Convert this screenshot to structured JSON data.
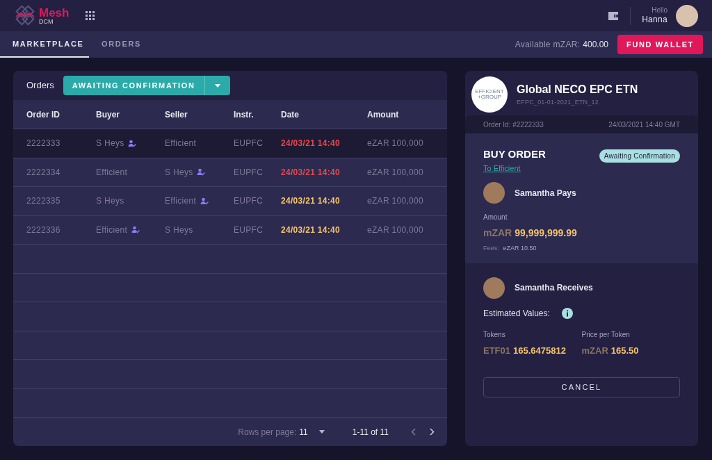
{
  "header": {
    "brand": "Mesh",
    "brand_sub": "DCM",
    "greeting": "Hello",
    "user": "Hanna"
  },
  "tabs": [
    {
      "label": "MARKETPLACE",
      "selected": true
    },
    {
      "label": "ORDERS",
      "selected": false
    }
  ],
  "wallet": {
    "label": "Available mZAR:",
    "value": "400.00",
    "button": "FUND WALLET"
  },
  "orders": {
    "title": "Orders",
    "filter": "AWAITING CONFIRMATION",
    "columns": [
      "Order ID",
      "Buyer",
      "Seller",
      "Instr.",
      "Date",
      "Amount"
    ],
    "rows": [
      {
        "id": "2222333",
        "buyer": {
          "name": "S Heys",
          "verified": true
        },
        "seller": {
          "name": "Efficient",
          "verified": false
        },
        "instr": "EUPFC",
        "date": "24/03/21 14:40",
        "urgent": true,
        "amount": "eZAR 100,000",
        "selected": true
      },
      {
        "id": "2222334",
        "buyer": {
          "name": "Efficient",
          "verified": false
        },
        "seller": {
          "name": "S Heys",
          "verified": true
        },
        "instr": "EUPFC",
        "date": "24/03/21 14:40",
        "urgent": true,
        "amount": "eZAR 100,000",
        "selected": false
      },
      {
        "id": "2222335",
        "buyer": {
          "name": "S Heys",
          "verified": false
        },
        "seller": {
          "name": "Efficient",
          "verified": true
        },
        "instr": "EUPFC",
        "date": "24/03/21 14:40",
        "urgent": false,
        "amount": "eZAR 100,000",
        "selected": false
      },
      {
        "id": "2222336",
        "buyer": {
          "name": "Efficient",
          "verified": true
        },
        "seller": {
          "name": "S Heys",
          "verified": false
        },
        "instr": "EUPFC",
        "date": "24/03/21 14:40",
        "urgent": false,
        "amount": "eZAR 100,000",
        "selected": false
      }
    ],
    "pagination": {
      "rows_label": "Rows per page:",
      "rows_value": "11",
      "range": "1-11 of 11"
    }
  },
  "detail": {
    "logo_text": [
      "EFFICIENT",
      "+GROUP"
    ],
    "title": "Global NECO EPC ETN",
    "code": "EFPC_01-01-2021_ETN_12",
    "order_id": "Order Id: #2222333",
    "timestamp": "24/03/2021 14:40 GMT",
    "order_type": "BUY ORDER",
    "counterparty": "To Efficient",
    "status": "Awaiting Confirmation",
    "payer": "Samantha Pays",
    "amount_label": "Amount",
    "amount_currency": "mZAR",
    "amount_value": "99,999,999.99",
    "fees_label": "Fees:",
    "fees_value": "eZAR 10.50",
    "receiver": "Samantha Receives",
    "estimated_label": "Estimated Values:",
    "tokens_label": "Tokens",
    "tokens_unit": "ETF01",
    "tokens_value": "165.6475812",
    "price_label": "Price per Token",
    "price_unit": "mZAR",
    "price_value": "165.50",
    "cancel": "CANCEL"
  }
}
